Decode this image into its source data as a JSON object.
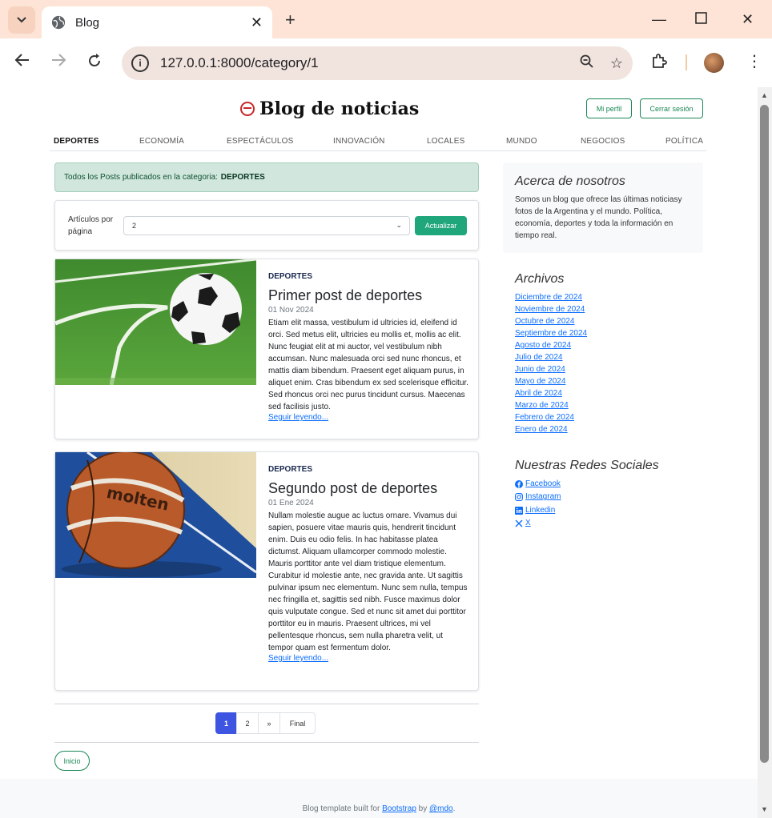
{
  "browser": {
    "tab_title": "Blog",
    "url": "127.0.0.1:8000/category/1"
  },
  "header": {
    "brand": "Blog de noticias",
    "profile_button": "Mi perfil",
    "logout_button": "Cerrar sesión"
  },
  "categories": [
    "DEPORTES",
    "ECONOMÍA",
    "ESPECTÁCULOS",
    "INNOVACIÓN",
    "LOCALES",
    "MUNDO",
    "NEGOCIOS",
    "POLÍTICA"
  ],
  "alert": {
    "text": "Todos los Posts publicados en la categoria:",
    "category": "DEPORTES"
  },
  "per_page": {
    "label": "Artículos por página",
    "selected": "2",
    "button": "Actualizar"
  },
  "posts": [
    {
      "category": "DEPORTES",
      "title": "Primer post de deportes",
      "date": "01 Nov 2024",
      "excerpt": "Etiam elit massa, vestibulum id ultricies id, eleifend id orci. Sed metus elit, ultricies eu mollis et, mollis ac elit. Nunc feugiat elit at mi auctor, vel vestibulum nibh accumsan. Nunc malesuada orci sed nunc rhoncus, et mattis diam bibendum. Praesent eget aliquam purus, in aliquet enim. Cras bibendum ex sed scelerisque efficitur. Sed rhoncus orci nec purus tincidunt cursus. Maecenas sed facilisis justo.",
      "read_more": "Seguir leyendo..."
    },
    {
      "category": "DEPORTES",
      "title": "Segundo post de deportes",
      "date": "01 Ene 2024",
      "excerpt": "Nullam molestie augue ac luctus ornare. Vivamus dui sapien, posuere vitae mauris quis, hendrerit tincidunt enim. Duis eu odio felis. In hac habitasse platea dictumst. Aliquam ullamcorper commodo molestie. Mauris porttitor ante vel diam tristique elementum. Curabitur id molestie ante, nec gravida ante. Ut sagittis pulvinar ipsum nec elementum. Nunc sem nulla, tempus nec fringilla et, sagittis sed nibh. Fusce maximus dolor quis vulputate congue. Sed et nunc sit amet dui porttitor porttitor eu in mauris. Praesent ultrices, mi vel pellentesque rhoncus, sem nulla pharetra velit, ut tempor quam est fermentum dolor.",
      "read_more": "Seguir leyendo...",
      "image_brand": "molten"
    }
  ],
  "sidebar": {
    "about_title": "Acerca de nosotros",
    "about_text": "Somos un blog que ofrece las últimas noticiasy fotos de la Argentina y el mundo. Política, economía, deportes y toda la información en tiempo real.",
    "archives_title": "Archivos",
    "archives": [
      "Diciembre de 2024",
      "Noviembre de 2024",
      "Octubre de 2024",
      "Septiembre de 2024",
      "Agosto de 2024",
      "Julio de 2024",
      "Junio de 2024",
      "Mayo de 2024",
      "Abril de 2024",
      "Marzo de 2024",
      "Febrero de 2024",
      "Enero de 2024"
    ],
    "social_title": "Nuestras Redes Sociales",
    "social": [
      {
        "label": " Facebook",
        "icon": "facebook-icon"
      },
      {
        "label": " Instagram",
        "icon": "instagram-icon"
      },
      {
        "label": " Linkedin",
        "icon": "linkedin-icon"
      },
      {
        "label": " X",
        "icon": "x-icon"
      }
    ]
  },
  "pagination": {
    "pages": [
      "1",
      "2"
    ],
    "next": "»",
    "last": "Final"
  },
  "home_button": "Inicio",
  "footer": {
    "prefix": "Blog template built for",
    "bootstrap": "Bootstrap",
    "by": "by",
    "author": "@mdo",
    "suffix": "."
  }
}
